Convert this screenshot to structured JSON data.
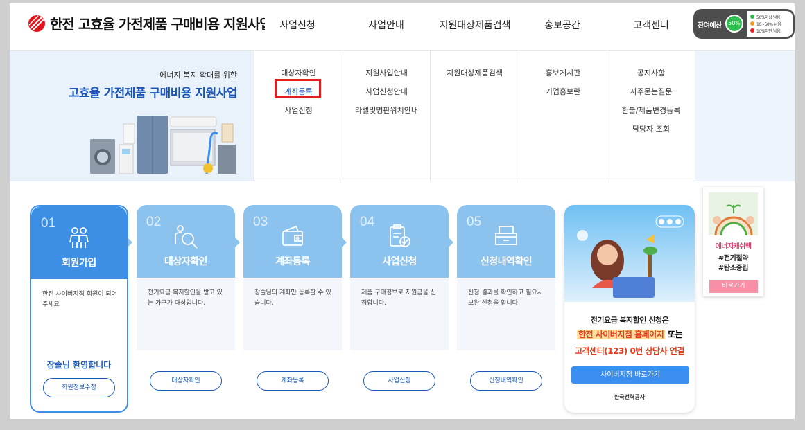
{
  "header": {
    "logo_text": "한전 고효율 가전제품 구매비용 지원사업",
    "nav": [
      "사업신청",
      "사업안내",
      "지원대상제품검색",
      "홍보공간",
      "고객센터"
    ],
    "budget": {
      "label": "잔여예산",
      "gauge_text": "50%",
      "legend": [
        {
          "text": "50%이상 남음",
          "color": "#2fbf4f"
        },
        {
          "text": "10~50% 남음",
          "color": "#f39c1f"
        },
        {
          "text": "10%미만 남음",
          "color": "#e02020"
        }
      ]
    }
  },
  "mega": {
    "promo_sub": "에너지 복지 확대를 위한",
    "promo_title": "고효율 가전제품 구매비용 지원사업",
    "columns": [
      [
        "대상자확인",
        "계좌등록",
        "사업신청"
      ],
      [
        "지원사업안내",
        "사업신청안내",
        "라벨및명판위치안내"
      ],
      [
        "지원대상제품검색"
      ],
      [
        "홍보게시판",
        "기업홍보란"
      ],
      [
        "공지사항",
        "자주묻는질문",
        "환불/제품변경등록",
        "담당자 조회"
      ]
    ],
    "active_item": "계좌등록"
  },
  "steps": [
    {
      "num": "01",
      "title": "회원가입",
      "desc": "한전 사이버지점 회원이 되어주세요",
      "welcome": "장솔님 환영합니다",
      "button": "회원정보수정",
      "icon": "users-icon"
    },
    {
      "num": "02",
      "title": "대상자확인",
      "desc": "전기요금 복지할인을 받고 있는 가구가 대상입니다.",
      "button": "대상자확인",
      "icon": "person-search-icon"
    },
    {
      "num": "03",
      "title": "계좌등록",
      "desc": "장솔님의 계좌만 등록할 수 있습니다.",
      "button": "계좌등록",
      "icon": "wallet-icon"
    },
    {
      "num": "04",
      "title": "사업신청",
      "desc": "제품 구매정보로 지원금을 신청합니다.",
      "button": "사업신청",
      "icon": "clipboard-check-icon"
    },
    {
      "num": "05",
      "title": "신청내역확인",
      "desc": "신청 결과를 확인하고 필요시 보완 신청을 합니다.",
      "button": "신청내역확인",
      "icon": "inbox-icon"
    }
  ],
  "ad": {
    "line1": "전기요금 복지할인 신청은",
    "line2_hl": "한전 사이버지점 홈페이지",
    "line2_tail": " 또는",
    "line3": "고객센터(123) 0번 상담사 연결",
    "button": "사이버지점 바로가기",
    "corp": "한국전력공사"
  },
  "side": {
    "title": "에너지캐쉬백",
    "tags": [
      "#전기절약",
      "#탄소중립"
    ],
    "button": "바로가기"
  },
  "colors": {
    "primary": "#3d8fe6",
    "light_blue": "#8cc3ee",
    "accent_text": "#1a56b8",
    "highlight_red": "#e02020"
  }
}
